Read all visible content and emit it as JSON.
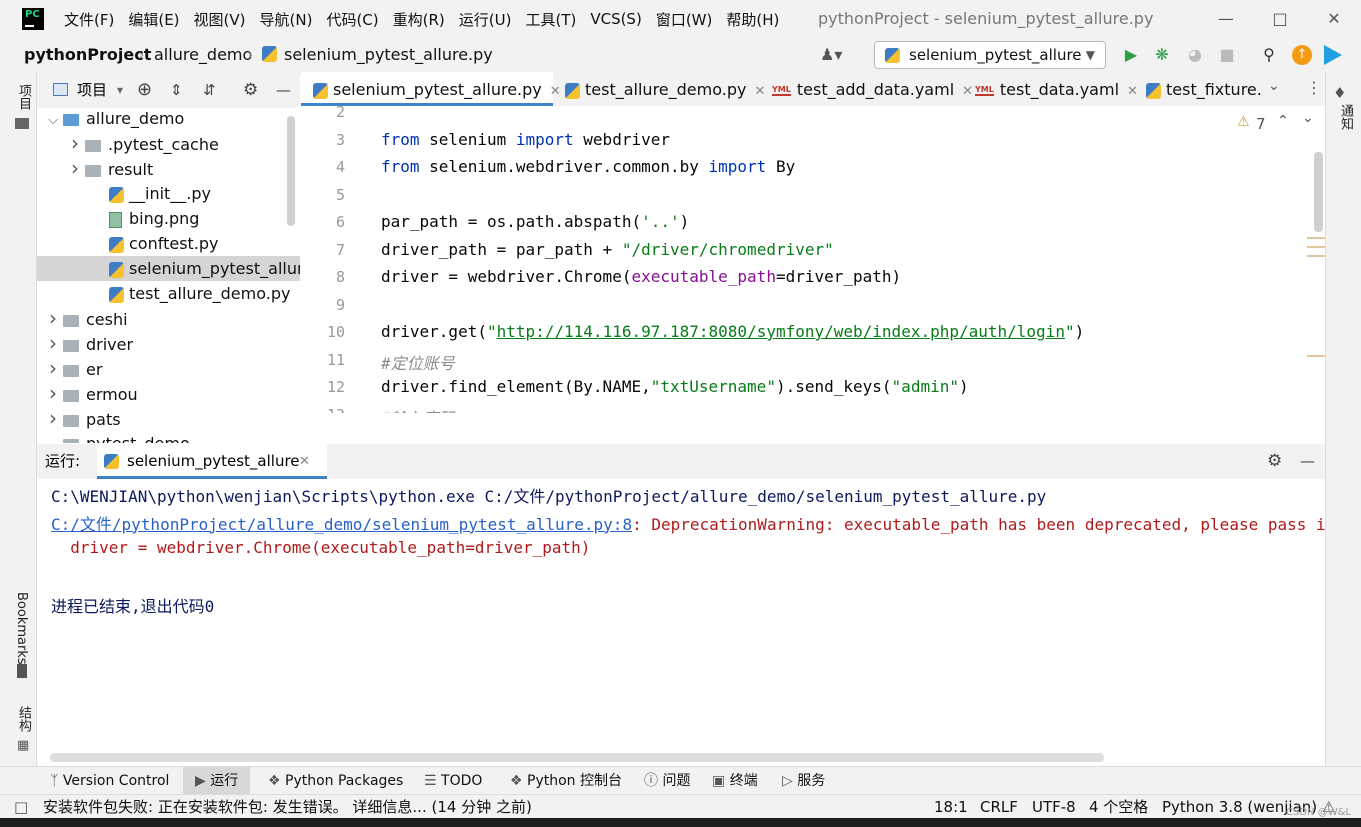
{
  "title_bar": {
    "logo": "PC",
    "menu": [
      "文件(F)",
      "编辑(E)",
      "视图(V)",
      "导航(N)",
      "代码(C)",
      "重构(R)",
      "运行(U)",
      "工具(T)",
      "VCS(S)",
      "窗口(W)",
      "帮助(H)"
    ],
    "window_title": "pythonProject - selenium_pytest_allure.py"
  },
  "breadcrumb": [
    "pythonProject",
    "allure_demo",
    "selenium_pytest_allure.py"
  ],
  "run_config": "selenium_pytest_allure",
  "left_strip": {
    "project": "项目",
    "bookmarks": "Bookmarks",
    "structure": "结构"
  },
  "right_strip": {
    "notifications": "通知"
  },
  "project_panel": {
    "title": "项目",
    "tree": [
      {
        "label": "allure_demo",
        "kind": "folder-blue",
        "expanded": true,
        "depth": 1
      },
      {
        "label": ".pytest_cache",
        "kind": "folder",
        "expanded": false,
        "depth": 2
      },
      {
        "label": "result",
        "kind": "folder",
        "expanded": false,
        "depth": 2
      },
      {
        "label": "__init__.py",
        "kind": "py",
        "depth": 2
      },
      {
        "label": "bing.png",
        "kind": "png",
        "depth": 2
      },
      {
        "label": "conftest.py",
        "kind": "py",
        "depth": 2
      },
      {
        "label": "selenium_pytest_allure.py",
        "kind": "py",
        "depth": 2,
        "selected": true
      },
      {
        "label": "test_allure_demo.py",
        "kind": "py",
        "depth": 2
      },
      {
        "label": "ceshi",
        "kind": "folder",
        "expanded": false,
        "depth": 1
      },
      {
        "label": "driver",
        "kind": "folder",
        "expanded": false,
        "depth": 1
      },
      {
        "label": "er",
        "kind": "folder",
        "expanded": false,
        "depth": 1
      },
      {
        "label": "ermou",
        "kind": "folder",
        "expanded": false,
        "depth": 1
      },
      {
        "label": "pats",
        "kind": "folder",
        "expanded": false,
        "depth": 1
      },
      {
        "label": "pytest_demo",
        "kind": "folder",
        "expanded": true,
        "depth": 1
      }
    ]
  },
  "editor_tabs": [
    {
      "label": "selenium_pytest_allure.py",
      "kind": "py",
      "active": true
    },
    {
      "label": "test_allure_demo.py",
      "kind": "py"
    },
    {
      "label": "test_add_data.yaml",
      "kind": "yml"
    },
    {
      "label": "test_data.yaml",
      "kind": "yml"
    },
    {
      "label": "test_fixture.",
      "kind": "py"
    }
  ],
  "yml_badge": "YML",
  "warnings_count": "7",
  "editor": {
    "line_numbers": [
      "2",
      "3",
      "4",
      "5",
      "6",
      "7",
      "8",
      "9",
      "10",
      "11",
      "12",
      "13"
    ],
    "lines": [
      [],
      [
        {
          "t": "from",
          "c": "kw"
        },
        {
          "t": " selenium ",
          "c": ""
        },
        {
          "t": "import",
          "c": "kw"
        },
        {
          "t": " webdriver",
          "c": ""
        }
      ],
      [
        {
          "t": "from",
          "c": "kw"
        },
        {
          "t": " selenium.webdriver.common.by ",
          "c": ""
        },
        {
          "t": "import",
          "c": "kw"
        },
        {
          "t": " By",
          "c": ""
        }
      ],
      [],
      [
        {
          "t": "par_path = os.path.abspath(",
          "c": ""
        },
        {
          "t": "'..'",
          "c": "str"
        },
        {
          "t": ")",
          "c": ""
        }
      ],
      [
        {
          "t": "driver_path = par_path + ",
          "c": ""
        },
        {
          "t": "\"/driver/chromedriver\"",
          "c": "str"
        }
      ],
      [
        {
          "t": "driver = webdriver.Chrome(",
          "c": ""
        },
        {
          "t": "executable_path",
          "c": "param"
        },
        {
          "t": "=driver_path)",
          "c": ""
        }
      ],
      [],
      [
        {
          "t": "driver.get(",
          "c": ""
        },
        {
          "t": "\"",
          "c": "str"
        },
        {
          "t": "http://114.116.97.187:8080/symfony/web/index.php/auth/login",
          "c": "url"
        },
        {
          "t": "\"",
          "c": "str"
        },
        {
          "t": ")",
          "c": ""
        }
      ],
      [
        {
          "t": "#定位账号",
          "c": "cmt"
        }
      ],
      [
        {
          "t": "driver.find_element(By.NAME,",
          "c": ""
        },
        {
          "t": "\"txtUsername\"",
          "c": "str"
        },
        {
          "t": ").send_keys(",
          "c": ""
        },
        {
          "t": "\"admin\"",
          "c": "str"
        },
        {
          "t": ")",
          "c": ""
        }
      ],
      [
        {
          "t": "#输入密码",
          "c": "cmt"
        }
      ]
    ]
  },
  "run_panel": {
    "label": "运行:",
    "tab": "selenium_pytest_allure",
    "console": [
      [
        {
          "t": "C:\\WENJIAN\\python\\wenjian\\Scripts\\python.exe C:/文件/pythonProject/allure_demo/selenium_pytest_allure.py",
          "c": "c-cmd"
        }
      ],
      [
        {
          "t": "C:/文件/pythonProject/allure_demo/selenium_pytest_allure.py:8",
          "c": "c-link"
        },
        {
          "t": ": DeprecationWarning: executable_path has been deprecated, please pass in a Service object",
          "c": "c-err"
        }
      ],
      [
        {
          "t": "  driver = webdriver.Chrome(executable_path=driver_path)",
          "c": "c-err"
        }
      ],
      [],
      [
        {
          "t": "进程已结束,退出代码0",
          "c": "c-cmd"
        }
      ]
    ]
  },
  "bottom_tools": [
    "Version Control",
    "运行",
    "Python Packages",
    "TODO",
    "Python 控制台",
    "问题",
    "终端",
    "服务"
  ],
  "status_bar": {
    "message": "安装软件包失败: 正在安装软件包: 发生错误。 详细信息... (14 分钟 之前)",
    "position": "18:1",
    "line_sep": "CRLF",
    "encoding": "UTF-8",
    "indent": "4 个空格",
    "interpreter": "Python 3.8 (wenjian)"
  },
  "watermark": "CSDN @W&L"
}
